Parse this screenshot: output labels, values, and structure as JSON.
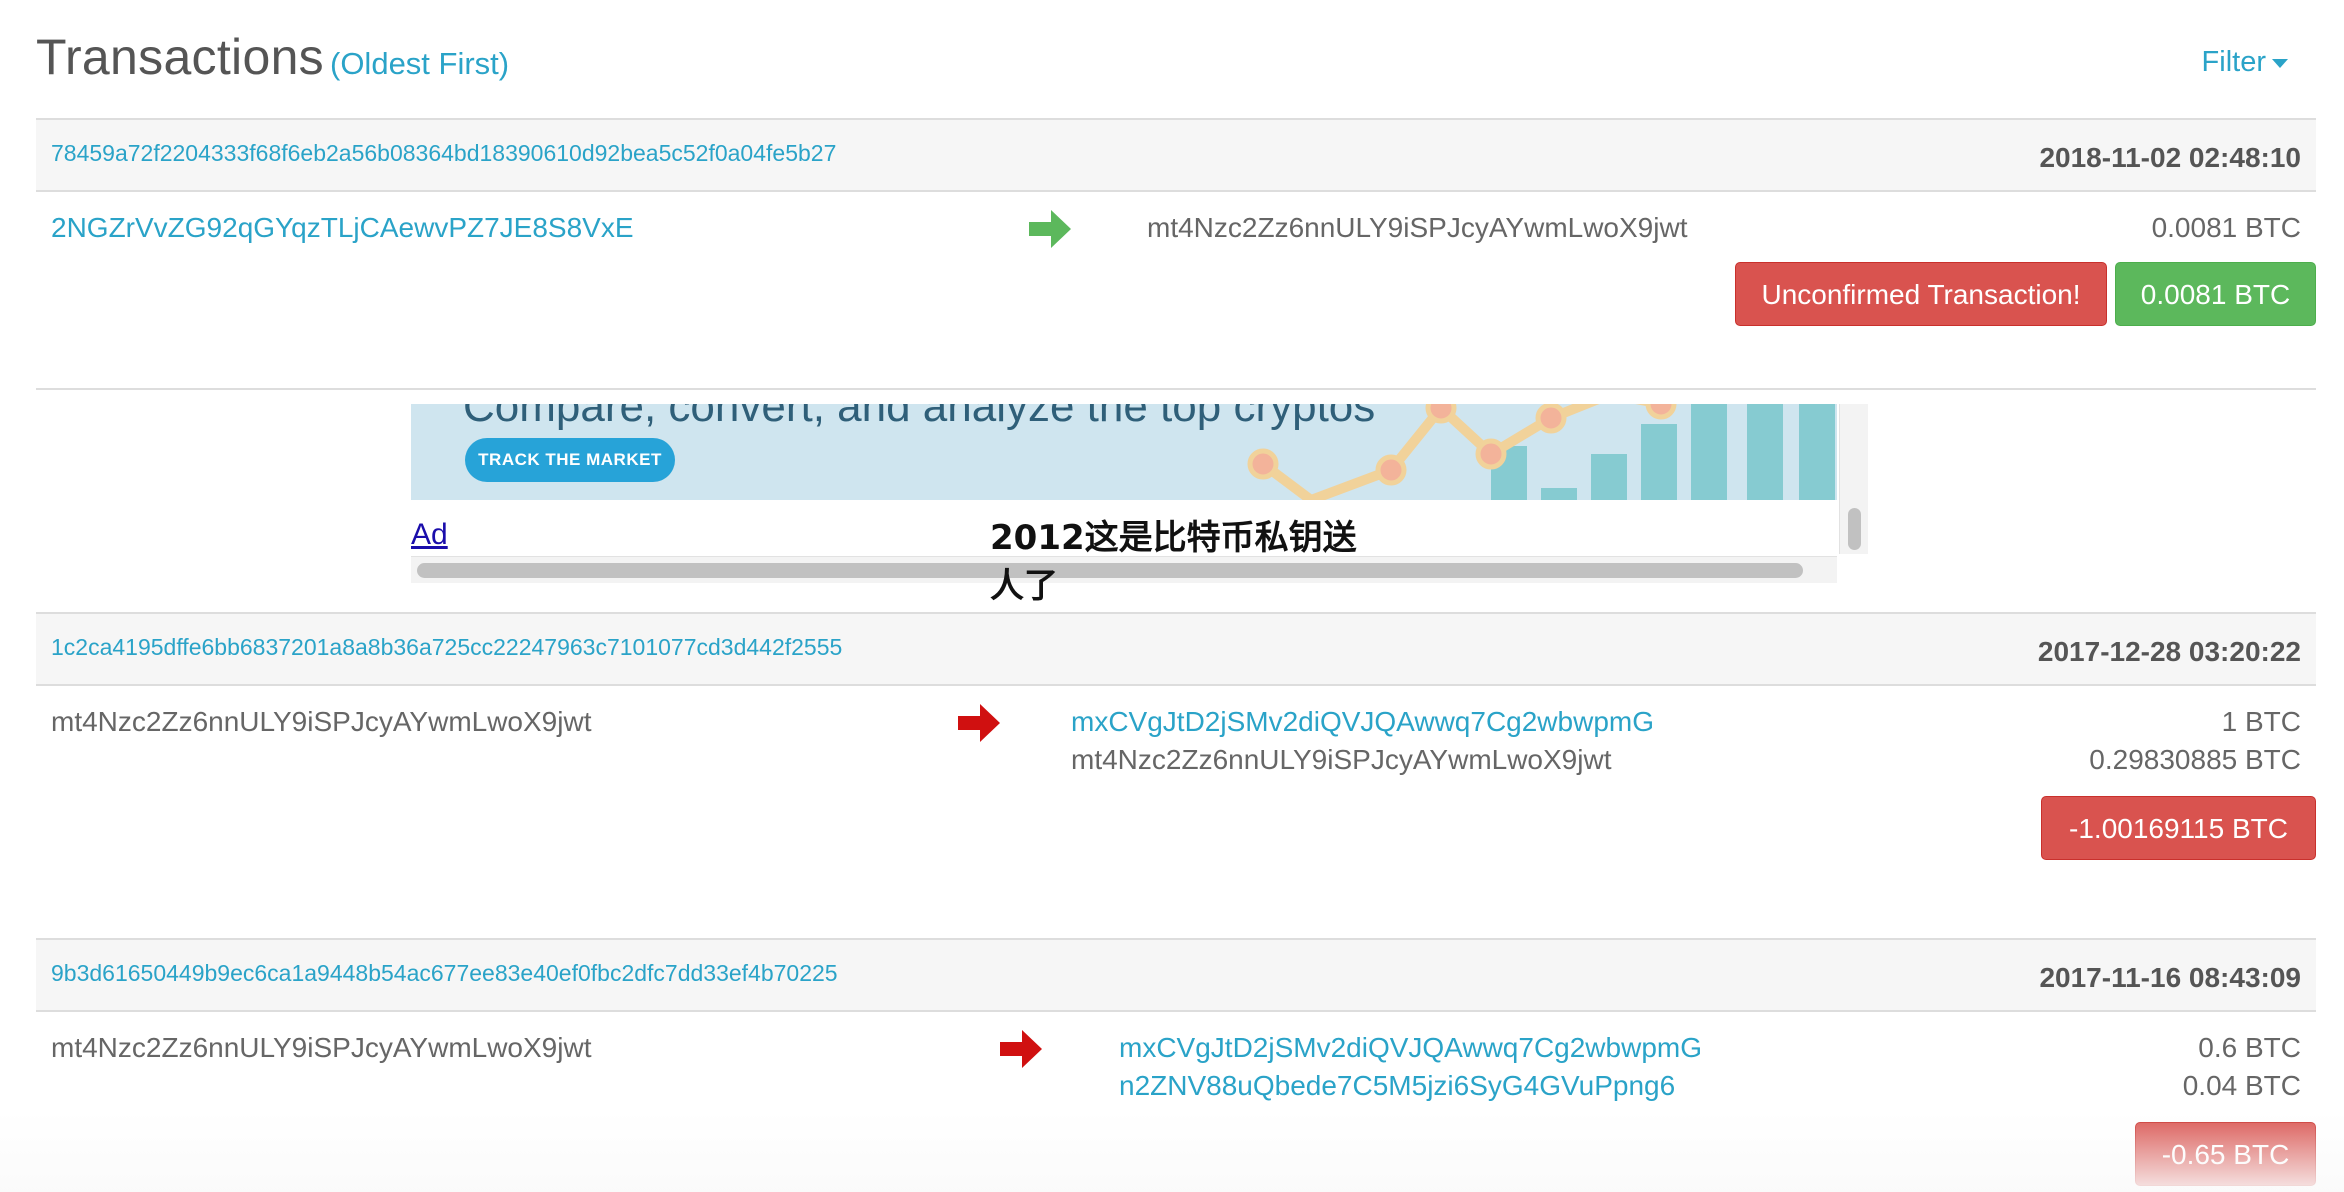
{
  "header": {
    "title": "Transactions",
    "subtitle": "(Oldest First)",
    "filter_label": "Filter"
  },
  "transactions": [
    {
      "hash": "78459a72f2204333f68f6eb2a56b08364bd18390610d92bea5c52f0a04fe5b27",
      "time": "2018-11-02 02:48:10",
      "from": "2NGZrVvZG92qGYqzTLjCAewvPZ7JE8S8VxE",
      "arrow": "green",
      "outputs": [
        {
          "address": "mt4Nzc2Zz6nnULY9iSPJcyAYwmLwoX9jwt",
          "amount": "0.0081 BTC"
        }
      ],
      "status_label": "Unconfirmed Transaction!",
      "total": "0.0081 BTC"
    },
    {
      "hash": "1c2ca4195dffe6bb6837201a8a8b36a725cc22247963c7101077cd3d442f2555",
      "time": "2017-12-28 03:20:22",
      "from": "mt4Nzc2Zz6nnULY9iSPJcyAYwmLwoX9jwt",
      "arrow": "red",
      "outputs": [
        {
          "address": "mxCVgJtD2jSMv2diQVJQAwwq7Cg2wbwpmG",
          "amount": "1 BTC"
        },
        {
          "address": "mt4Nzc2Zz6nnULY9iSPJcyAYwmLwoX9jwt",
          "amount": "0.29830885 BTC"
        }
      ],
      "total": "-1.00169115 BTC"
    },
    {
      "hash": "9b3d61650449b9ec6ca1a9448b54ac677ee83e40ef0fbc2dfc7dd33ef4b70225",
      "time": "2017-11-16 08:43:09",
      "from": "mt4Nzc2Zz6nnULY9iSPJcyAYwmLwoX9jwt",
      "arrow": "red",
      "outputs": [
        {
          "address": "mxCVgJtD2jSMv2diQVJQAwwq7Cg2wbwpmG",
          "amount": "0.6 BTC"
        },
        {
          "address": "n2ZNV88uQbede7C5M5jzi6SyG4GVuPpng6",
          "amount": "0.04 BTC"
        }
      ],
      "total": "-0.65 BTC"
    }
  ],
  "ad": {
    "headline": "Compare, convert, and analyze the top cryptos",
    "button_label": "TRACK THE MARKET",
    "label": "Ad"
  },
  "watermark": "2012这是比特币私钥送人了",
  "colors": {
    "link": "#2aa3c8",
    "danger": "#d9534f",
    "success": "#5cb85c",
    "arrow_green": "#5cb85c",
    "arrow_red": "#d01010"
  }
}
